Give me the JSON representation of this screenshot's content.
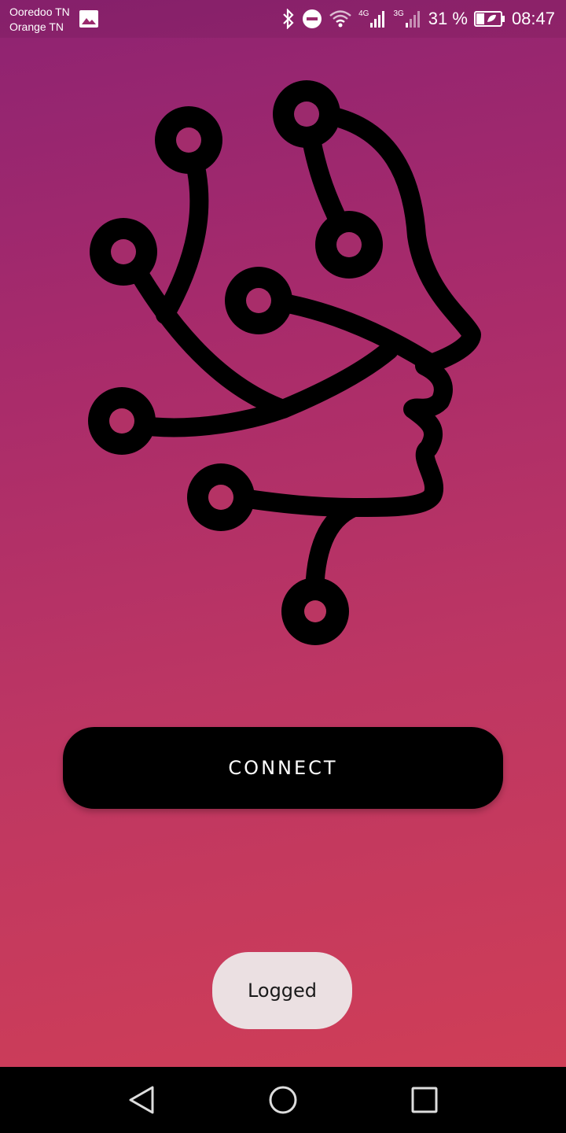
{
  "status_bar": {
    "carrier_1": "Ooredoo TN",
    "carrier_2": "Orange TN",
    "network_1": "4G",
    "network_2": "3G",
    "battery_percent": "31 %",
    "time": "08:47",
    "icons": [
      "gallery-icon",
      "bluetooth-icon",
      "do-not-disturb-icon",
      "wifi-icon",
      "signal-icon",
      "signal-icon",
      "battery-saver-icon"
    ]
  },
  "main": {
    "logo_icon": "circuit-head-icon",
    "connect_label": "CONNECT"
  },
  "toast": {
    "message": "Logged"
  },
  "nav_bar": {
    "icons": [
      "back-icon",
      "home-icon",
      "recents-icon"
    ]
  },
  "colors": {
    "gradient_top": "#8e2372",
    "gradient_bottom": "#d23f55",
    "button": "#000000",
    "toast_bg": "#ebe0e2"
  }
}
